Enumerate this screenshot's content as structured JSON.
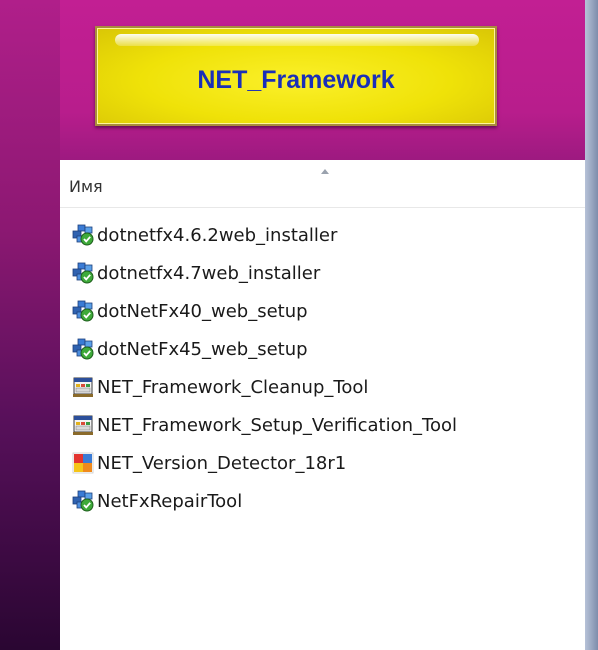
{
  "banner": {
    "title": "NET_Framework"
  },
  "explorer": {
    "column_name": "Имя",
    "files": [
      {
        "name": "dotnetfx4.6.2web_installer",
        "icon": "installer-icon"
      },
      {
        "name": "dotnetfx4.7web_installer",
        "icon": "installer-icon"
      },
      {
        "name": "dotNetFx40_web_setup",
        "icon": "installer-icon"
      },
      {
        "name": "dotNetFx45_web_setup",
        "icon": "installer-icon"
      },
      {
        "name": "NET_Framework_Cleanup_Tool",
        "icon": "tool-app-icon"
      },
      {
        "name": "NET_Framework_Setup_Verification_Tool",
        "icon": "tool-app-icon"
      },
      {
        "name": "NET_Version_Detector_18r1",
        "icon": "detector-app-icon"
      },
      {
        "name": "NetFxRepairTool",
        "icon": "installer-icon"
      }
    ]
  },
  "colors": {
    "background_magenta": "#b81d8c",
    "banner_yellow": "#efe208",
    "banner_text_blue": "#1a2fb8"
  }
}
